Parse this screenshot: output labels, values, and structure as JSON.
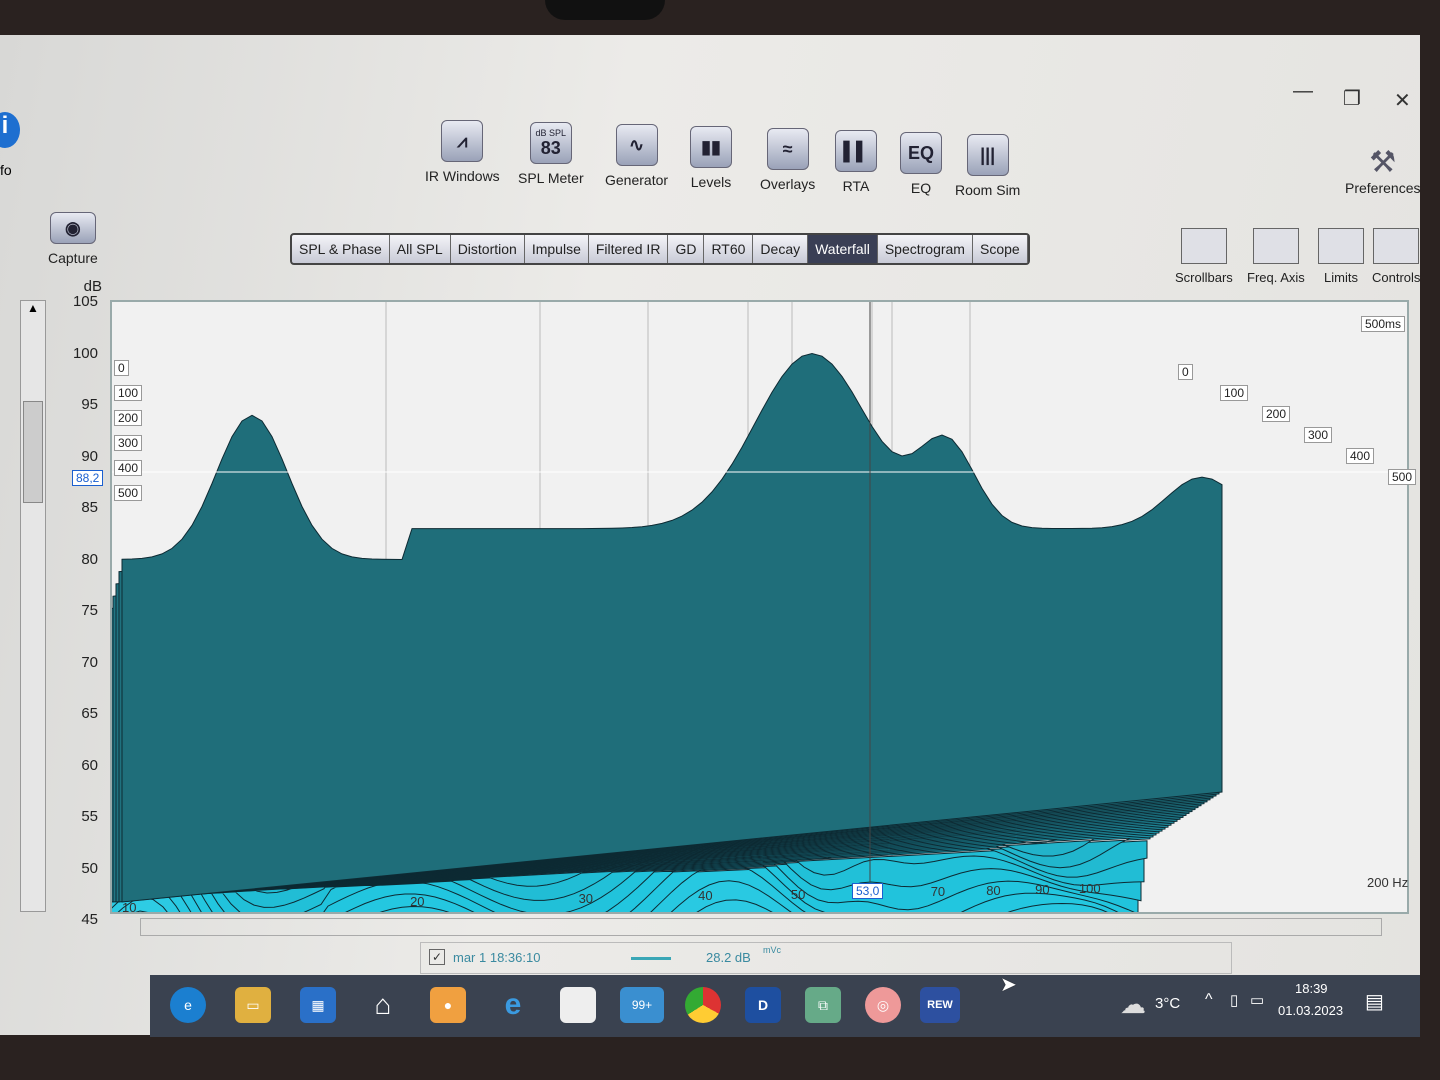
{
  "window": {
    "controls": [
      "—",
      "❐",
      "✕"
    ],
    "info_label": "fo"
  },
  "toolbar": [
    {
      "label": "IR Windows",
      "icon": "ir-windows-icon",
      "glyph": "⩘"
    },
    {
      "label": "SPL Meter",
      "icon": "spl-meter-icon",
      "glyph": "83",
      "sub": "dB SPL"
    },
    {
      "label": "Generator",
      "icon": "generator-icon",
      "glyph": "∿"
    },
    {
      "label": "Levels",
      "icon": "levels-icon",
      "glyph": "▮▮"
    },
    {
      "label": "Overlays",
      "icon": "overlays-icon",
      "glyph": "≈"
    },
    {
      "label": "RTA",
      "icon": "rta-icon",
      "glyph": "▌▌"
    },
    {
      "label": "EQ",
      "icon": "eq-icon",
      "glyph": "EQ"
    },
    {
      "label": "Room Sim",
      "icon": "room-sim-icon",
      "glyph": "|||"
    }
  ],
  "preferences": "Preferences",
  "capture": "Capture",
  "tabs": [
    "SPL & Phase",
    "All SPL",
    "Distortion",
    "Impulse",
    "Filtered IR",
    "GD",
    "RT60",
    "Decay",
    "Waterfall",
    "Spectrogram",
    "Scope"
  ],
  "active_tab": "Waterfall",
  "right_tools": [
    "Scrollbars",
    "Freq. Axis",
    "Limits",
    "Controls"
  ],
  "chart_data": {
    "type": "area",
    "title": "Waterfall",
    "ylabel": "dB",
    "ylim": [
      45,
      105
    ],
    "yticks": [
      "105",
      "100",
      "95",
      "90",
      "85",
      "80",
      "75",
      "70",
      "65",
      "60",
      "55",
      "50",
      "45"
    ],
    "xlabel": "Hz",
    "xlim": [
      10,
      200
    ],
    "xticks": [
      "10",
      "20",
      "30",
      "40",
      "50",
      "60",
      "70",
      "80",
      "90",
      "100",
      "200 Hz"
    ],
    "time_ticks": [
      "0",
      "100",
      "200",
      "300",
      "400",
      "500"
    ],
    "time_max": "500ms",
    "cursor_level": "88,2",
    "cursor_freq": "53,0",
    "peak_db": 97,
    "peak_freq_hz": 50
  },
  "legend": {
    "checked": true,
    "name": "mar 1 18:36:10",
    "value": "28.2 dB",
    "suffix": "mVc",
    "color": "#3aa7b6"
  },
  "taskbar": {
    "weather": "3°C",
    "time": "18:39",
    "date": "01.03.2023",
    "badge": "99+",
    "rew": "REW"
  }
}
